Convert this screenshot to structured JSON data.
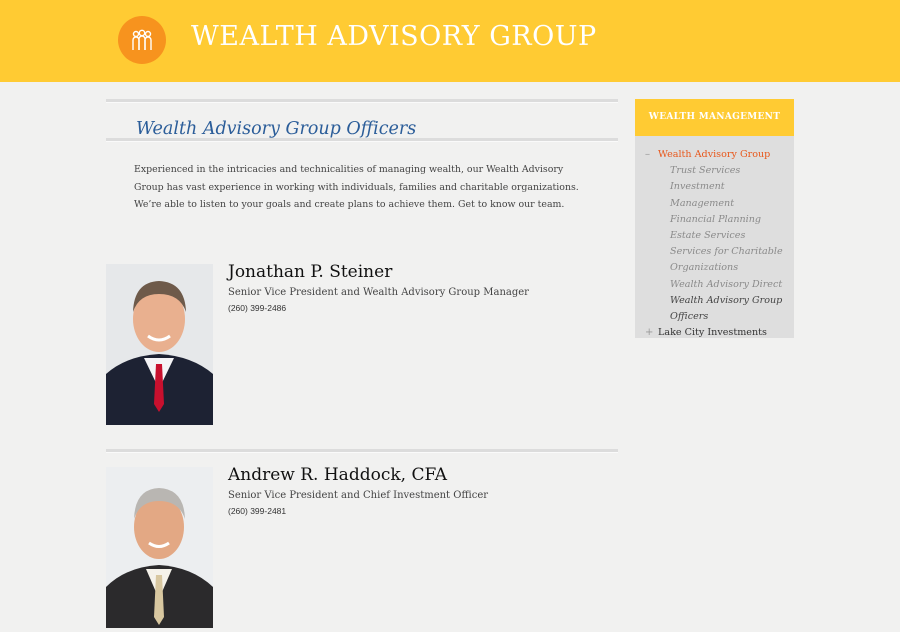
{
  "header": {
    "site_title": "WEALTH ADVISORY GROUP",
    "logo_icon": "people-group-icon",
    "background_color": "#ffcb33",
    "logo_color": "#f7931e"
  },
  "main": {
    "page_title": "Wealth Advisory Group Officers",
    "intro": "Experienced in the intricacies and technicalities of managing wealth, our Wealth Advisory Group has vast experience in working with individuals, families and charitable organizations. We’re able to listen to your goals and create plans to achieve them. Get to know our team.",
    "officers": [
      {
        "name": "Jonathan P. Steiner",
        "title": "Senior Vice President and Wealth Advisory Group Manager",
        "phone": "(260) 399-2486"
      },
      {
        "name": "Andrew R. Haddock, CFA",
        "title": "Senior Vice President and Chief Investment Officer",
        "phone": "(260) 399-2481"
      }
    ]
  },
  "sidebar": {
    "heading": "WEALTH MANAGEMENT",
    "items": [
      {
        "label": "Wealth Advisory Group",
        "marker": "–"
      },
      {
        "label": "Trust Services"
      },
      {
        "label": "Investment Management"
      },
      {
        "label": "Financial Planning"
      },
      {
        "label": "Estate Services"
      },
      {
        "label": "Services for Charitable Organizations"
      },
      {
        "label": "Wealth Advisory Direct"
      },
      {
        "label": "Wealth Advisory Group Officers"
      },
      {
        "label": "Lake City Investments",
        "marker": "+"
      }
    ],
    "active_color": "#e8581c"
  }
}
